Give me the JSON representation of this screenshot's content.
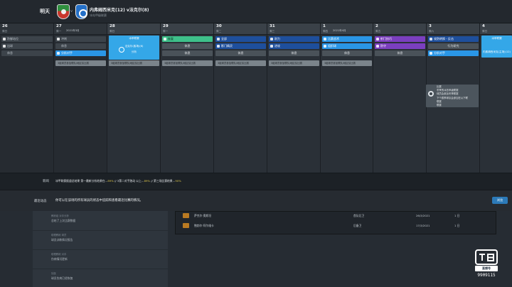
{
  "header": {
    "tomorrow_label": "明天",
    "vs": "v",
    "match_title": "内弗姆西米克(12) v法克尔(8)",
    "competition": "冰岛甲级联赛"
  },
  "calendar": {
    "days": [
      {
        "num": "26",
        "weekday": "周日",
        "month": ""
      },
      {
        "num": "27",
        "weekday": "周一",
        "month": "2021年3月"
      },
      {
        "num": "28",
        "weekday": "周日",
        "month": ""
      },
      {
        "num": "29",
        "weekday": "周一",
        "month": ""
      },
      {
        "num": "30",
        "weekday": "周二",
        "month": ""
      },
      {
        "num": "31",
        "weekday": "周三",
        "month": ""
      },
      {
        "num": "1",
        "weekday": "周四",
        "month": "2021年4月"
      },
      {
        "num": "2",
        "weekday": "周五",
        "month": ""
      },
      {
        "num": "3",
        "weekday": "周六",
        "month": ""
      },
      {
        "num": "4",
        "weekday": "周日",
        "month": ""
      }
    ],
    "d26": [
      "防御站位",
      "出球",
      "休息"
    ],
    "d27": [
      "冲刺",
      "休息",
      "分析对手"
    ],
    "d28_match": {
      "top": "冰甲联赛",
      "mid": "法克尔(客场)(6)",
      "bot": "分析"
    },
    "d29": [
      "恢复",
      "休息",
      "休息"
    ],
    "d30": [
      "全部",
      "影门精灵",
      "休息"
    ],
    "d31": [
      "耐力",
      "进攻",
      "休息"
    ],
    "d1": [
      "比赛战术",
      "组织球",
      "休息"
    ],
    "d2": [
      "射门技巧",
      "防守",
      "休息"
    ],
    "d3": [
      "攻防转换 - 反击",
      "行为研究",
      "分析对手"
    ],
    "d4_match": {
      "top": "冰甲联赛",
      "mid": "内弗姆西米克(主场)(12)"
    },
    "band_text": "3组球员参加联队/地区队比赛",
    "popup_lines": [
      "比赛",
      "冬季的冰岛甲级联赛",
      "球员会参加冬季联赛",
      "下个赛季球队会参加在以下联",
      "联赛",
      "联赛"
    ]
  },
  "news": {
    "label": "新闻",
    "prefix": "冰甲联赛报道总结果 第一最新分析结果在…",
    "h1": "89%",
    "mid": "// 3第二对手跑动 以上…",
    "h2": "89%",
    "end": "// 第三场比赛结果…",
    "h3": "90%"
  },
  "rule": {
    "label": "最近动态",
    "text": "你可以在该场的所有球员的状态中追踪和查看最近比赛的情况。",
    "button": "浏览"
  },
  "inbox": [
    {
      "from": "教练组 对手分析",
      "subject": "总结了上次比赛数据"
    },
    {
      "from": "助理教练 球员",
      "subject": "球员训练情况报告"
    },
    {
      "from": "助理教练 对手",
      "subject": "伤病情况更新"
    },
    {
      "from": "队医",
      "subject": "球员伤病已经恢复"
    }
  ],
  "table": [
    {
      "name": "萨克尔·奥斯坦",
      "role": "首队后卫",
      "date": "26/3/2021",
      "len": "1 日"
    },
    {
      "name": "鲍勃尔·阿尔维卡",
      "role": "后备卫",
      "date": "17/3/2021",
      "len": "1 日"
    }
  ],
  "watermark": {
    "logo": "斗鱼",
    "sub": "直播号",
    "id": "9909115"
  },
  "colors": {
    "green": "#3ec08a",
    "dark_blue": "#1e4f9c",
    "blue": "#2a96e6",
    "purple": "#7b3fbf",
    "match_blue": "#34a7e8",
    "button_blue": "#2c7ab8"
  }
}
